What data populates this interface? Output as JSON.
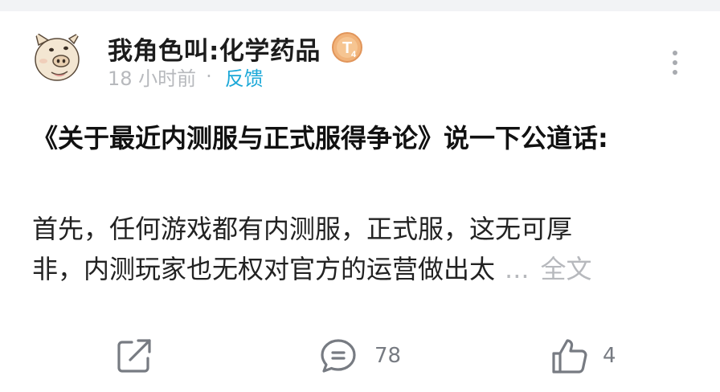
{
  "post": {
    "author": {
      "name": "我角色叫:化学药品",
      "avatar_icon": "cartoon-pig-face-avatar",
      "level_badge": "T",
      "level_badge_sub": "4"
    },
    "time": "18 小时前",
    "meta_separator": "·",
    "feedback_label": "反馈",
    "more_icon": "vertical-dots-icon",
    "title": "《关于最近内测服与正式服得争论》说一下公道话:",
    "body_lines": [
      "首先，任何游戏都有内测服，正式服，这无可厚",
      "非，内测玩家也无权对官方的运营做出太"
    ],
    "ellipsis": "...",
    "read_more_label": "全文"
  },
  "actions": {
    "share_icon": "share-icon",
    "comment_icon": "comment-icon",
    "comment_count": "78",
    "like_icon": "thumbs-up-icon",
    "like_count": "4"
  },
  "colors": {
    "link": "#1ba8d8",
    "meta": "#b7b9bd",
    "icon": "#777b82",
    "badge": "#e8a76a"
  }
}
